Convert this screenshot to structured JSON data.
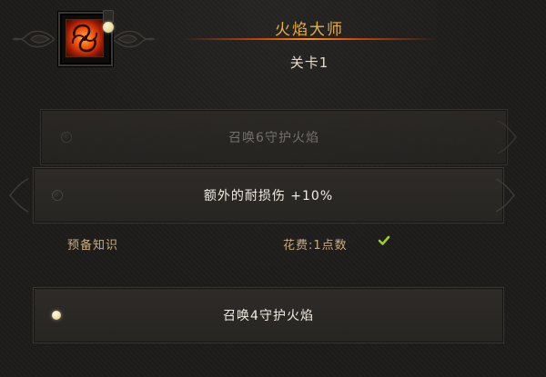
{
  "header": {
    "title": "火焰大师",
    "subtitle": "关卡1",
    "icon": "fire-vortex-icon"
  },
  "ranks": [
    {
      "label": "召唤6守护火焰",
      "state": "locked"
    },
    {
      "label": "额外的耐损伤 +10%",
      "state": "selected"
    },
    {
      "label": "召唤4守护火焰",
      "state": "available"
    }
  ],
  "requirements": {
    "prerequisite_label": "预备知识",
    "cost_label": "花费:1点数"
  },
  "colors": {
    "title": "#e5ae48",
    "title_line": "#ff8a2a",
    "check": "#9acd32",
    "meta_text": "#c8ad82"
  }
}
